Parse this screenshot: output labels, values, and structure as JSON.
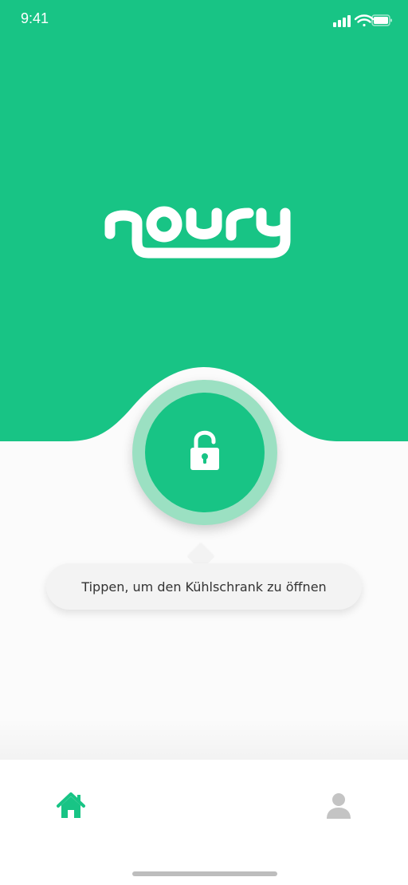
{
  "status_bar": {
    "time": "9:41"
  },
  "brand": {
    "name": "noury",
    "color": "#18c485",
    "ring_color": "#9be0c2"
  },
  "lock": {
    "icon": "unlocked-padlock-icon",
    "state": "unlocked"
  },
  "tooltip": {
    "text": "Tippen, um den Kühlschrank zu öffnen"
  },
  "tab_bar": {
    "items": [
      {
        "icon": "home-icon",
        "active": true,
        "color": "#18c485"
      },
      {
        "icon": "user-icon",
        "active": false,
        "color": "#c4c4c4"
      }
    ]
  }
}
